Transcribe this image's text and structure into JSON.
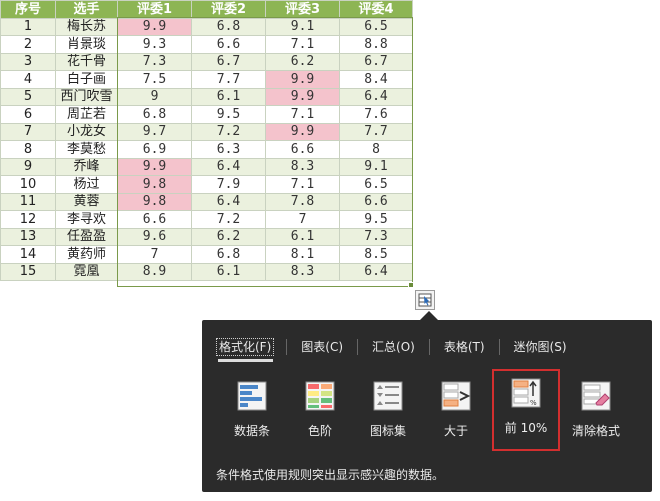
{
  "table": {
    "headers": [
      "序号",
      "选手",
      "评委1",
      "评委2",
      "评委3",
      "评委4"
    ],
    "rows": [
      {
        "idx": "1",
        "name": "梅长苏",
        "s1": "9.9",
        "s2": "6.8",
        "s3": "9.1",
        "s4": "6.5"
      },
      {
        "idx": "2",
        "name": "肖景琰",
        "s1": "9.3",
        "s2": "6.6",
        "s3": "7.1",
        "s4": "8.8"
      },
      {
        "idx": "3",
        "name": "花千骨",
        "s1": "7.3",
        "s2": "6.7",
        "s3": "6.2",
        "s4": "6.7"
      },
      {
        "idx": "4",
        "name": "白子画",
        "s1": "7.5",
        "s2": "7.7",
        "s3": "9.9",
        "s4": "8.4"
      },
      {
        "idx": "5",
        "name": "西门吹雪",
        "s1": "9",
        "s2": "6.1",
        "s3": "9.9",
        "s4": "6.4"
      },
      {
        "idx": "6",
        "name": "周芷若",
        "s1": "6.8",
        "s2": "9.5",
        "s3": "7.1",
        "s4": "7.6"
      },
      {
        "idx": "7",
        "name": "小龙女",
        "s1": "9.7",
        "s2": "7.2",
        "s3": "9.9",
        "s4": "7.7"
      },
      {
        "idx": "8",
        "name": "李莫愁",
        "s1": "6.9",
        "s2": "6.3",
        "s3": "6.6",
        "s4": "8"
      },
      {
        "idx": "9",
        "name": "乔峰",
        "s1": "9.9",
        "s2": "6.4",
        "s3": "8.3",
        "s4": "9.1"
      },
      {
        "idx": "10",
        "name": "杨过",
        "s1": "9.8",
        "s2": "7.9",
        "s3": "7.1",
        "s4": "6.5"
      },
      {
        "idx": "11",
        "name": "黄蓉",
        "s1": "9.8",
        "s2": "6.4",
        "s3": "7.8",
        "s4": "6.6"
      },
      {
        "idx": "12",
        "name": "李寻欢",
        "s1": "6.6",
        "s2": "7.2",
        "s3": "7",
        "s4": "9.5"
      },
      {
        "idx": "13",
        "name": "任盈盈",
        "s1": "9.6",
        "s2": "6.2",
        "s3": "6.1",
        "s4": "7.3"
      },
      {
        "idx": "14",
        "name": "黄药师",
        "s1": "7",
        "s2": "6.8",
        "s3": "8.1",
        "s4": "8.5"
      },
      {
        "idx": "15",
        "name": "霓凰",
        "s1": "8.9",
        "s2": "6.1",
        "s3": "8.3",
        "s4": "6.4"
      }
    ],
    "highlighted_cells": [
      [
        0,
        "s1"
      ],
      [
        3,
        "s3"
      ],
      [
        4,
        "s3"
      ],
      [
        6,
        "s3"
      ],
      [
        8,
        "s1"
      ],
      [
        9,
        "s1"
      ],
      [
        10,
        "s1"
      ]
    ]
  },
  "colors": {
    "header_bg": "#8db554",
    "band_bg": "#ebf1de",
    "highlight_bg": "#f4c3cc",
    "panel_bg": "#2b2b2b",
    "selected_border": "#d32f2f"
  },
  "quick_analysis": {
    "button_icon": "quick-analysis-icon",
    "tabs": [
      {
        "label": "格式化(F)",
        "active": true
      },
      {
        "label": "图表(C)",
        "active": false
      },
      {
        "label": "汇总(O)",
        "active": false
      },
      {
        "label": "表格(T)",
        "active": false
      },
      {
        "label": "迷你图(S)",
        "active": false
      }
    ],
    "tools": [
      {
        "label": "数据条",
        "icon": "data-bars-icon",
        "selected": false
      },
      {
        "label": "色阶",
        "icon": "color-scale-icon",
        "selected": false
      },
      {
        "label": "图标集",
        "icon": "icon-set-icon",
        "selected": false
      },
      {
        "label": "大于",
        "icon": "greater-than-icon",
        "selected": false
      },
      {
        "label": "前 10%",
        "icon": "top-10-percent-icon",
        "selected": true
      },
      {
        "label": "清除格式",
        "icon": "clear-format-icon",
        "selected": false
      }
    ],
    "description": "条件格式使用规则突出显示感兴趣的数据。"
  }
}
